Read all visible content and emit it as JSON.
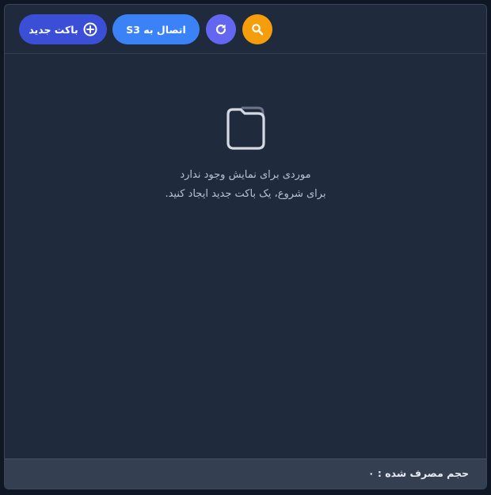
{
  "toolbar": {
    "new_bucket_label": "باکت جدید",
    "connect_s3_label": "اتصال به S3",
    "new_bucket_icon": "plus-circle-icon",
    "refresh_icon": "refresh-icon",
    "search_icon": "search-icon"
  },
  "empty_state": {
    "icon": "folder-icon",
    "line1": "موردی برای نمایش وجود ندارد",
    "line2": "برای شروع، یک باکت جدید ایجاد کنید."
  },
  "footer": {
    "usage_label": "حجم مصرف شده : ۰"
  },
  "colors": {
    "background": "#1f2a3d",
    "new_bucket": "#3b4fd6",
    "connect_s3": "#3b82f6",
    "refresh": "#6366f1",
    "search": "#f59e0b",
    "footer": "#343f52"
  }
}
